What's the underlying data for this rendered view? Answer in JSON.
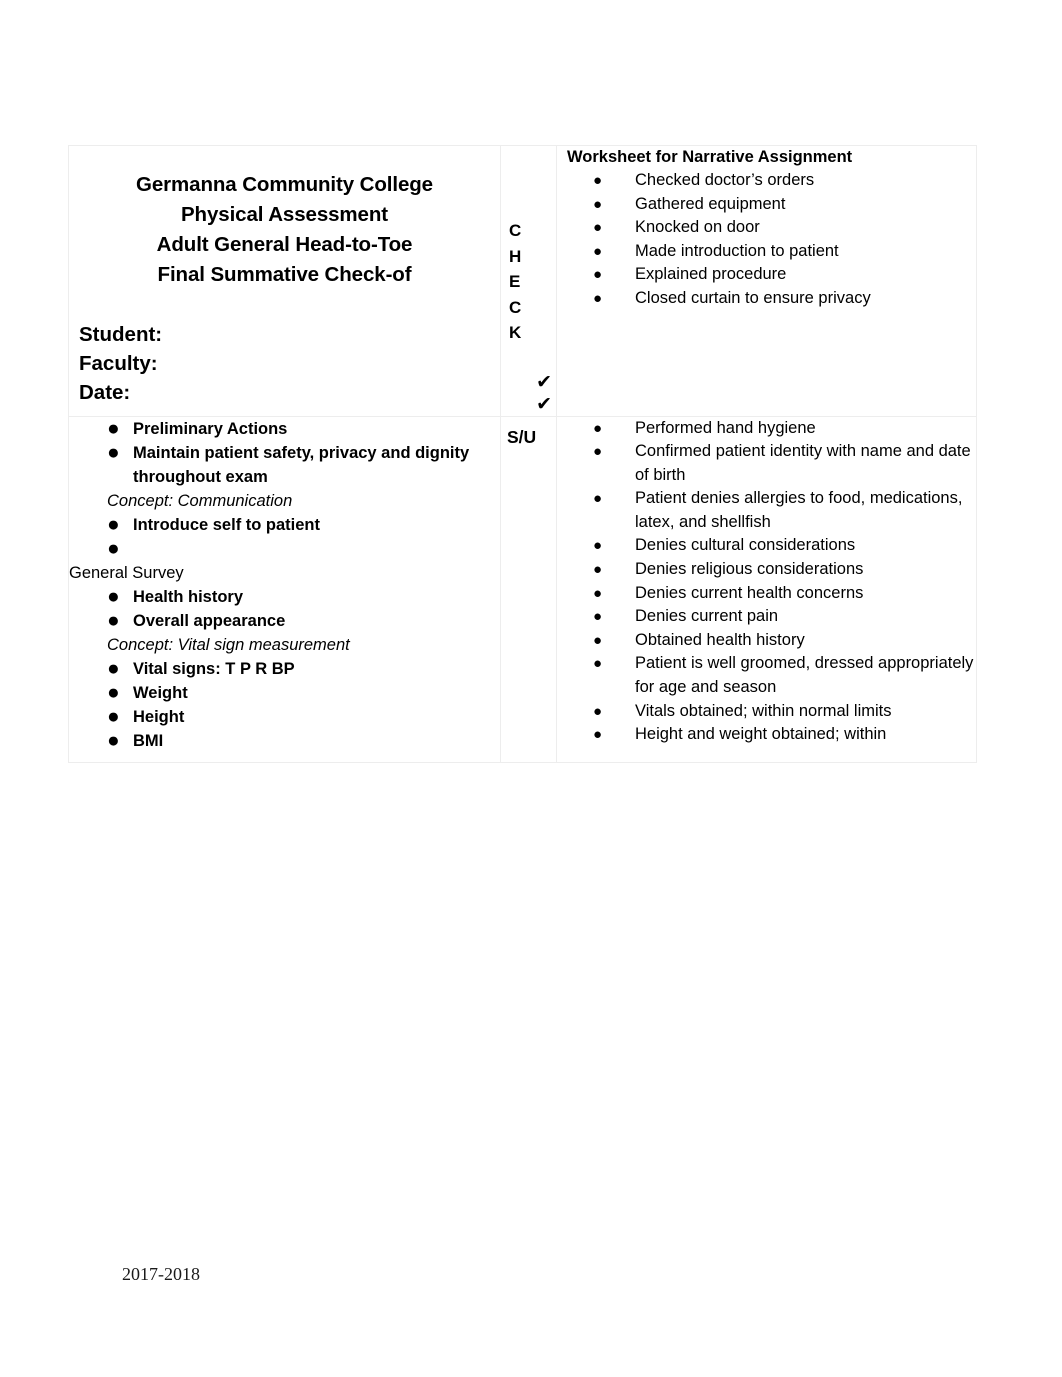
{
  "document": {
    "footer_year": "2017-2018"
  },
  "header_cell": {
    "title_lines": [
      "Germanna Community College",
      "Physical Assessment",
      "Adult General Head-to-Toe",
      "Final Summative Check-of"
    ],
    "fields": [
      "Student:",
      "Faculty:",
      "Date:"
    ]
  },
  "check_column": {
    "letters": [
      "C",
      "H",
      "E",
      "C",
      "K"
    ],
    "marks": [
      "✔",
      "✔"
    ],
    "su_label": "S/U"
  },
  "worksheet_cell": {
    "heading": "Worksheet for Narrative Assignment",
    "bullet_glyph": "●",
    "items": [
      "Checked doctor’s orders",
      "Gathered equipment",
      "Knocked on door",
      "Made introduction to patient",
      "Explained procedure",
      "Closed curtain to ensure privacy"
    ]
  },
  "skills_cell": {
    "bullet_glyph": "●",
    "blocks": [
      {
        "kind": "bullet",
        "text": "Preliminary Actions"
      },
      {
        "kind": "bullet",
        "text": "Maintain patient safety, privacy and dignity throughout exam"
      },
      {
        "kind": "concept",
        "text": "Concept: Communication"
      },
      {
        "kind": "bullet",
        "text": "Introduce self to patient"
      },
      {
        "kind": "bullet",
        "text": ""
      },
      {
        "kind": "section",
        "text": "General Survey"
      },
      {
        "kind": "bullet",
        "text": "Health history"
      },
      {
        "kind": "bullet",
        "text": "Overall appearance"
      },
      {
        "kind": "concept",
        "text": "Concept: Vital sign measurement"
      },
      {
        "kind": "bullet",
        "text": "Vital signs:   T P R BP"
      },
      {
        "kind": "bullet",
        "text": "Weight"
      },
      {
        "kind": "bullet",
        "text": "Height"
      },
      {
        "kind": "bullet",
        "text": "BMI"
      }
    ]
  },
  "narrative_cell": {
    "bullet_glyph": "●",
    "items": [
      "Performed hand hygiene",
      "Confirmed patient identity with name and date of birth",
      "Patient denies allergies to food, medications, latex, and shellfish",
      "Denies cultural considerations",
      "Denies religious considerations",
      "Denies current health concerns",
      "Denies current pain",
      "Obtained health history",
      "Patient is well groomed, dressed appropriately for age and season",
      "Vitals obtained; within normal limits",
      "Height and weight obtained; within"
    ]
  }
}
